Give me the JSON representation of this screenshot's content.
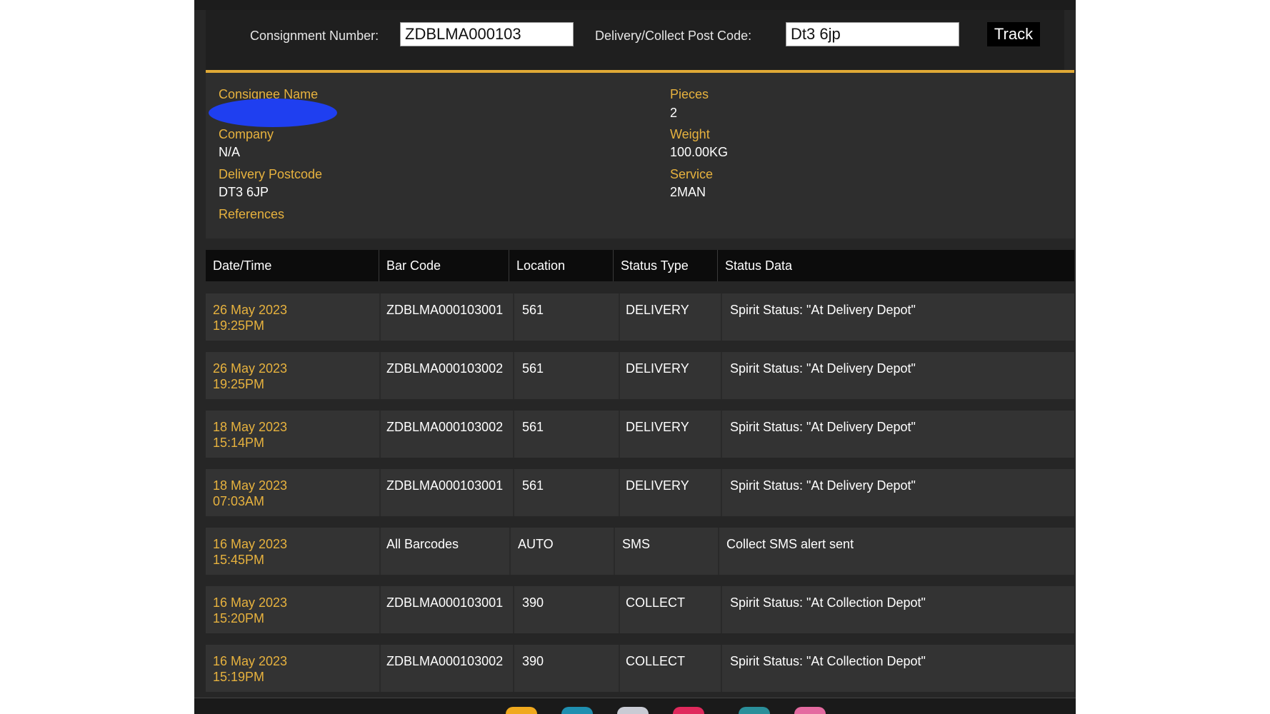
{
  "search": {
    "consignment_label": "Consignment Number:",
    "consignment_value": "ZDBLMA000103",
    "postcode_label": "Delivery/Collect Post Code:",
    "postcode_value": "Dt3 6jp",
    "track_label": "Track"
  },
  "details": {
    "consignee_name_label": "Consignee Name",
    "company_label": "Company",
    "company_value": "N/A",
    "delivery_postcode_label": "Delivery Postcode",
    "delivery_postcode_value": "DT3 6JP",
    "references_label": "References",
    "pieces_label": "Pieces",
    "pieces_value": "2",
    "weight_label": "Weight",
    "weight_value": "100.00KG",
    "service_label": "Service",
    "service_value": "2MAN"
  },
  "table": {
    "headers": [
      "Date/Time",
      "Bar Code",
      "Location",
      "Status Type",
      "Status Data"
    ],
    "rows": [
      {
        "date": "26 May 2023",
        "time": "19:25PM",
        "barcode": "ZDBLMA000103001",
        "location": "561",
        "status_type": "DELIVERY",
        "status_data": "Spirit Status: \"At Delivery Depot\""
      },
      {
        "date": "26 May 2023",
        "time": "19:25PM",
        "barcode": "ZDBLMA000103002",
        "location": "561",
        "status_type": "DELIVERY",
        "status_data": "Spirit Status: \"At Delivery Depot\""
      },
      {
        "date": "18 May 2023",
        "time": "15:14PM",
        "barcode": "ZDBLMA000103002",
        "location": "561",
        "status_type": "DELIVERY",
        "status_data": "Spirit Status: \"At Delivery Depot\""
      },
      {
        "date": "18 May 2023",
        "time": "07:03AM",
        "barcode": "ZDBLMA000103001",
        "location": "561",
        "status_type": "DELIVERY",
        "status_data": "Spirit Status: \"At Delivery Depot\""
      },
      {
        "date": "16 May 2023",
        "time": "15:45PM",
        "barcode": "All Barcodes",
        "location": "AUTO",
        "status_type": "SMS",
        "status_data": "Collect SMS alert sent"
      },
      {
        "date": "16 May 2023",
        "time": "15:20PM",
        "barcode": "ZDBLMA000103001",
        "location": "390",
        "status_type": "COLLECT",
        "status_data": "Spirit Status: \"At Collection Depot\""
      },
      {
        "date": "16 May 2023",
        "time": "15:19PM",
        "barcode": "ZDBLMA000103002",
        "location": "390",
        "status_type": "COLLECT",
        "status_data": "Spirit Status: \"At Collection Depot\""
      }
    ]
  },
  "colors": {
    "accent": "#e0a936",
    "label_gold": "#e7b23e",
    "panel_bg": "#262626",
    "redaction_blue": "#1f3ff0"
  },
  "dock": {
    "icons": [
      "app-icon-yellow",
      "app-icon-teal",
      "app-icon-gray",
      "app-icon-red",
      "app-icon-teal-2",
      "app-icon-pink"
    ]
  }
}
